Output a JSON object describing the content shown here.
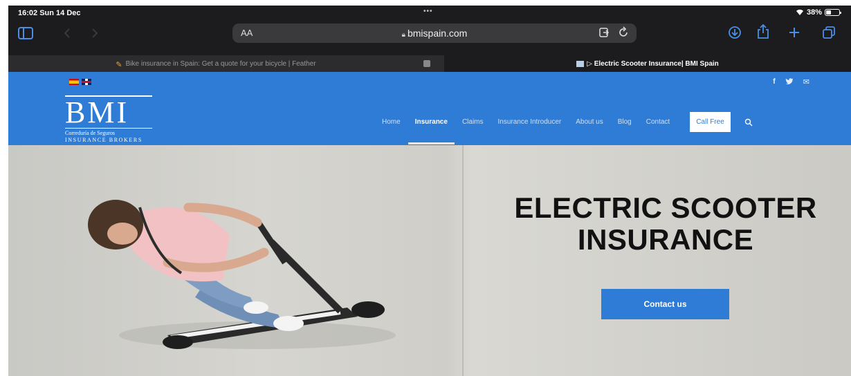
{
  "status_bar": {
    "time_date": "16:02  Sun 14 Dec",
    "dots": "•••",
    "battery_percent": "38%",
    "battery_level": 0.38
  },
  "browser": {
    "text_size_label": "AA",
    "url": "bmispain.com",
    "icons": {
      "sidebar": "sidebar-icon",
      "back": "back-icon",
      "forward": "forward-icon",
      "reader": "reader-icon",
      "reload": "reload-icon",
      "download": "download-icon",
      "share": "share-icon",
      "new_tab": "plus-icon",
      "tabs": "tabs-icon"
    },
    "accent": "#4a8fe6"
  },
  "tabs": [
    {
      "title": "Bike insurance in Spain: Get a quote for your bicycle | Feather",
      "active": false
    },
    {
      "title": "",
      "active": false
    },
    {
      "title": "▷ Electric Scooter Insurance| BMI Spain",
      "active": true
    }
  ],
  "site": {
    "brand_color": "#2f7cd6",
    "flags": [
      "es-flag",
      "uk-flag"
    ],
    "social": [
      "f",
      "t",
      "✉"
    ],
    "logo": {
      "wordmark": "BMI",
      "line1": "Correduría de Seguros",
      "line2": "INSURANCE  BROKERS"
    },
    "nav": {
      "items": [
        "Home",
        "Insurance",
        "Claims",
        "Insurance Introducer",
        "About us",
        "Blog",
        "Contact"
      ],
      "active": "Insurance",
      "cta": "Call Free",
      "search_icon": "search-icon"
    },
    "hero": {
      "title_line1": "ELECTRIC SCOOTER",
      "title_line2": "INSURANCE",
      "button": "Contact us"
    }
  }
}
